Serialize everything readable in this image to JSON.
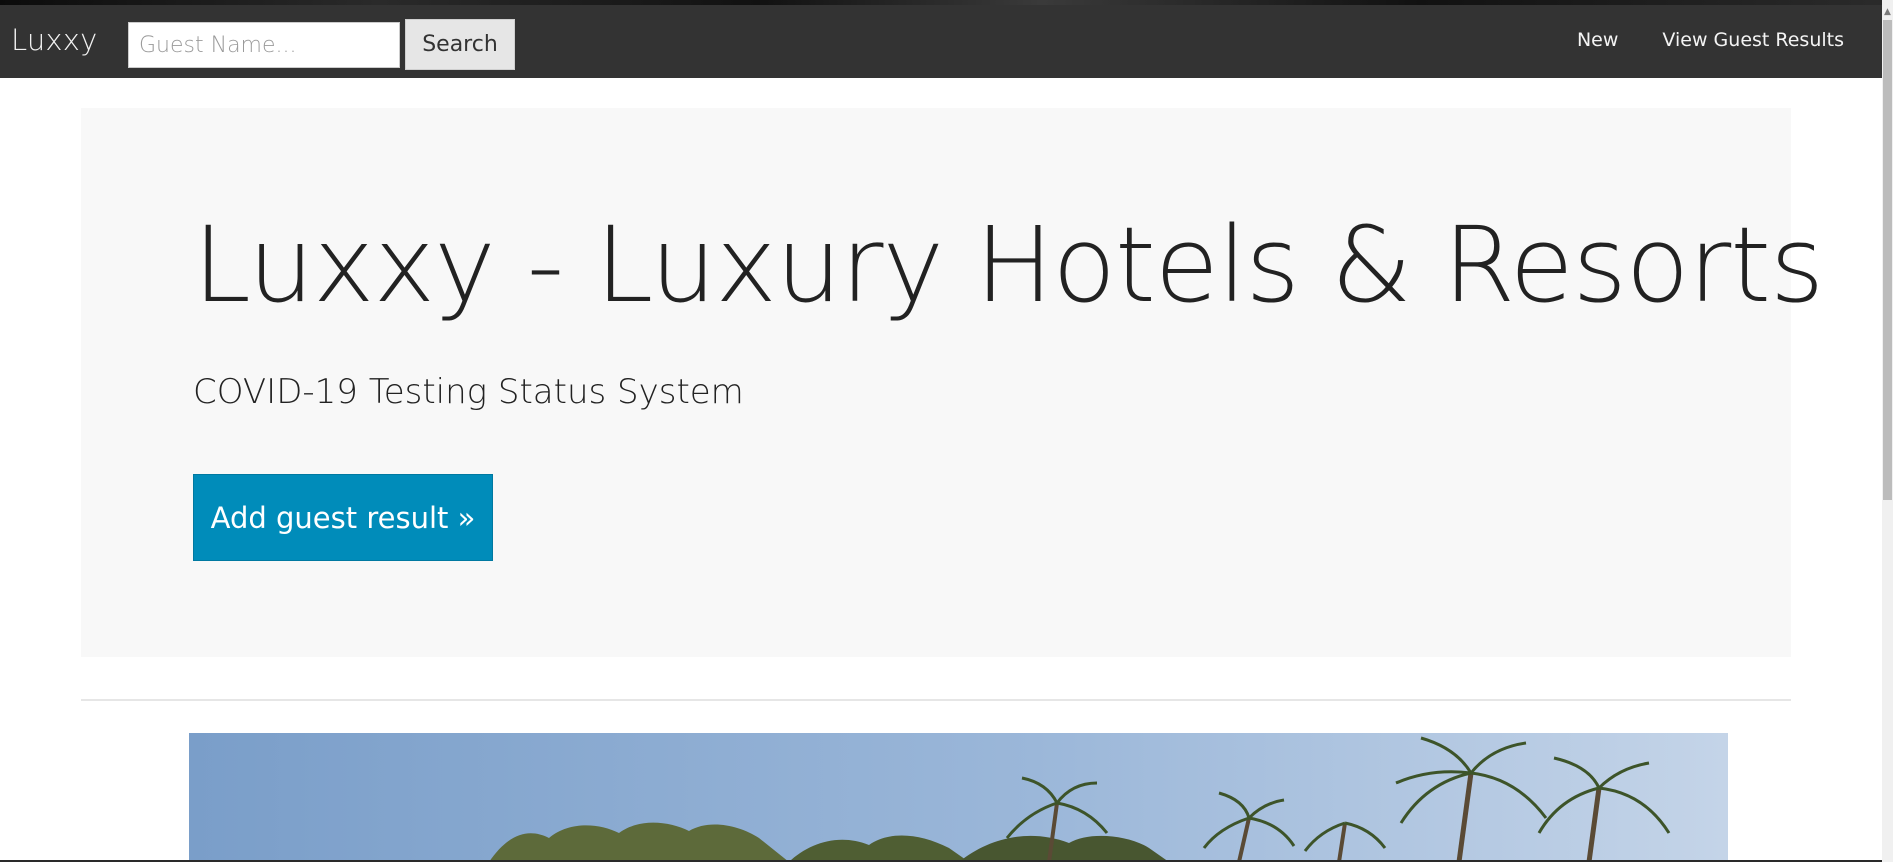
{
  "navbar": {
    "brand": "Luxxy",
    "search_placeholder": "Guest Name...",
    "search_button_label": "Search",
    "links": [
      {
        "label": "New"
      },
      {
        "label": "View Guest Results"
      }
    ]
  },
  "hero": {
    "title": "Luxxy - Luxury Hotels & Resorts",
    "subtitle": "COVID-19 Testing Status System",
    "button_label": "Add guest result »"
  },
  "colors": {
    "navbar_bg": "#333333",
    "jumbotron_bg": "#f8f8f8",
    "primary_button": "#008cba"
  },
  "image": {
    "description_icon": "hotel-photo"
  }
}
